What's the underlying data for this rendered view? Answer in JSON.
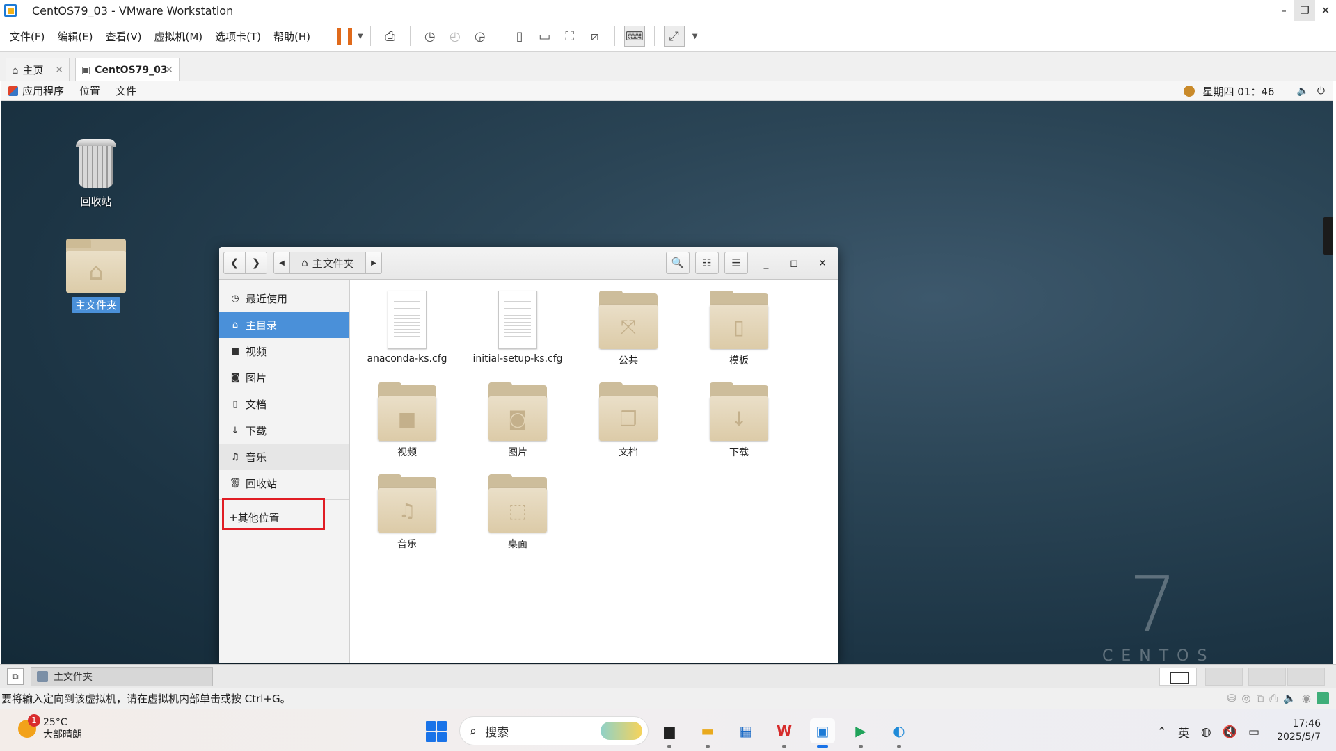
{
  "window": {
    "title": "CentOS79_03 - VMware Workstation"
  },
  "menu": [
    "文件(F)",
    "编辑(E)",
    "查看(V)",
    "虚拟机(M)",
    "选项卡(T)",
    "帮助(H)"
  ],
  "tabs": {
    "home": "主页",
    "vm": "CentOS79_03"
  },
  "gnome": {
    "apps": "应用程序",
    "places": "位置",
    "files": "文件",
    "clock": "星期四 01：46"
  },
  "desktop": {
    "trash": "回收站",
    "home": "主文件夹",
    "seven": "7",
    "centos": "CENTOS"
  },
  "nautilus": {
    "path": "主文件夹",
    "sidebar": [
      "最近使用",
      "主目录",
      "视频",
      "图片",
      "文档",
      "下载",
      "音乐",
      "回收站"
    ],
    "other": "其他位置",
    "files": [
      "anaconda-ks.cfg",
      "initial-setup-ks.cfg",
      "公共",
      "模板",
      "视频",
      "图片",
      "文档",
      "下载",
      "音乐",
      "桌面"
    ]
  },
  "vm_taskbar": {
    "task": "主文件夹"
  },
  "status": {
    "hint": "要将输入定向到该虚拟机，请在虚拟机内部单击或按 Ctrl+G。"
  },
  "taskbar": {
    "temp": "25°C",
    "weather": "大部晴朗",
    "badge": "1",
    "search": "搜索",
    "ime": "英",
    "time": "17:46",
    "date": "2025/5/7"
  },
  "colors": {
    "accent": "#4a90d9",
    "highlight": "#e01c24",
    "pause": "#e06a1b"
  }
}
